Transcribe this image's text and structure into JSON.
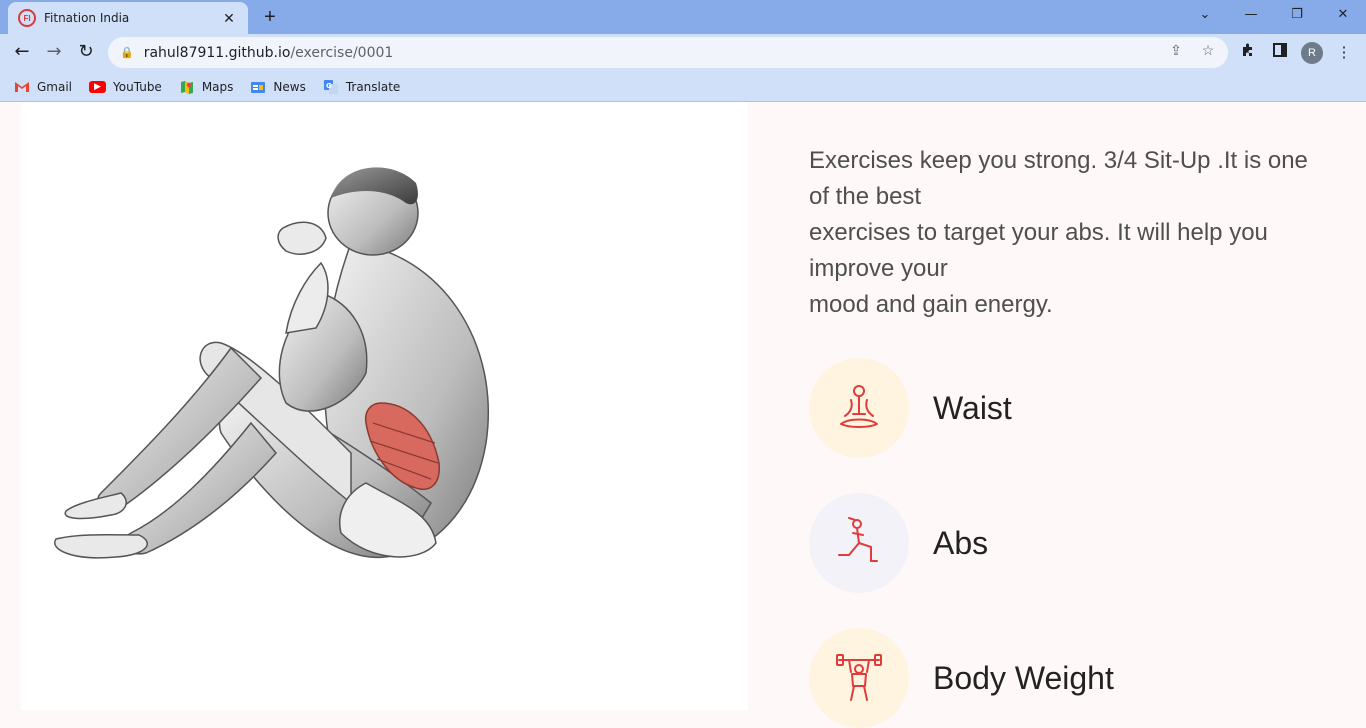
{
  "browser": {
    "tab_title": "Fitnation India",
    "tab_close": "✕",
    "favicon_text": "FI",
    "new_tab": "+",
    "url_domain": "rahul87911.github.io",
    "url_path": "/exercise/0001",
    "avatar_letter": "R",
    "bookmarks": [
      {
        "label": "Gmail",
        "icon": "gmail-icon",
        "color": "#ea4335"
      },
      {
        "label": "YouTube",
        "icon": "youtube-icon",
        "color": "#ff0000"
      },
      {
        "label": "Maps",
        "icon": "maps-icon",
        "color": "#34a853"
      },
      {
        "label": "News",
        "icon": "news-icon",
        "color": "#4285f4"
      },
      {
        "label": "Translate",
        "icon": "translate-icon",
        "color": "#4285f4"
      }
    ]
  },
  "exercise": {
    "description_lines": [
      "Exercises keep you strong. 3/4 Sit-Up .It is one",
      "of the best",
      "exercises to target your abs. It will help you",
      "improve your",
      "mood and gain energy."
    ],
    "image_name": "3/4 Sit-Up illustration",
    "body_parts": [
      {
        "label": "Waist",
        "icon": "meditation-icon",
        "bg": "#fff4e0"
      },
      {
        "label": "Abs",
        "icon": "lunge-icon",
        "bg": "#f3f2f8"
      },
      {
        "label": "Body Weight",
        "icon": "weightlifting-icon",
        "bg": "#fff4e0"
      }
    ]
  },
  "colors": {
    "accent": "#e03c3c",
    "muscle": "#d8695e",
    "tabstrip": "#86abe8",
    "toolbar": "#cfe0f8",
    "page_bg": "#fff8f8"
  }
}
